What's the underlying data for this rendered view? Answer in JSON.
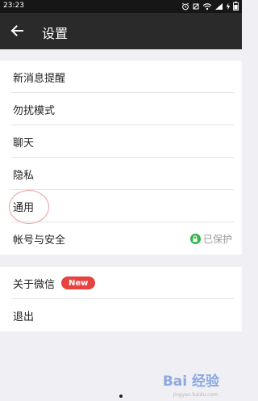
{
  "status_bar": {
    "time": "23:23",
    "icons": [
      "alarm-icon",
      "mute-icon",
      "wifi-icon",
      "signal-icon",
      "charging-icon",
      "battery-icon"
    ]
  },
  "app_bar": {
    "title": "设置"
  },
  "group_1": {
    "items": [
      {
        "label": "新消息提醒"
      },
      {
        "label": "勿扰模式"
      },
      {
        "label": "聊天"
      },
      {
        "label": "隐私"
      },
      {
        "label": "通用"
      },
      {
        "label": "帐号与安全",
        "status": "已保护"
      }
    ]
  },
  "group_2": {
    "items": [
      {
        "label": "关于微信",
        "badge": "New"
      },
      {
        "label": "退出"
      }
    ]
  },
  "watermark": {
    "text": "Bai  经验",
    "url": "jingyan.baidu.com"
  },
  "colors": {
    "app_bar": "#2a2a2a",
    "status_bar": "#161616",
    "background": "#efeff4",
    "badge_red": "#e64340",
    "lock_green": "#2fb54a",
    "highlight_circle": "#e8a0a0"
  }
}
